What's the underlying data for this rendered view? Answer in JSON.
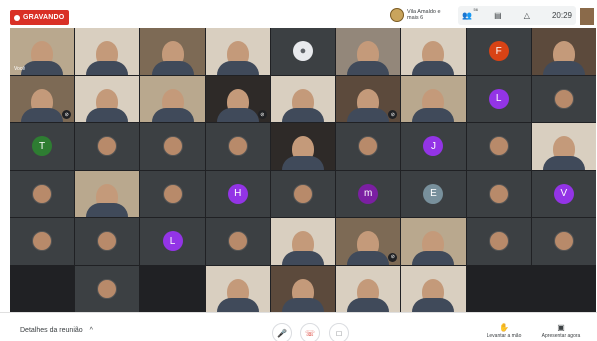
{
  "topbar": {
    "recording_label": "GRAVANDO",
    "pinned_name": "Vila Amaldo e mais 6",
    "people_icon": "people-icon",
    "people_count": "56",
    "chat_icon": "chat-icon",
    "activities_icon": "activities-icon",
    "clock": "20:29"
  },
  "grid": {
    "self_label": "Você",
    "tiles": [
      {
        "kind": "video",
        "bg": "wall-a",
        "label": "Você",
        "mic_off": false
      },
      {
        "kind": "video",
        "bg": "wall-c",
        "label": "",
        "mic_off": false
      },
      {
        "kind": "video",
        "bg": "wall-b",
        "label": "",
        "mic_off": false
      },
      {
        "kind": "video",
        "bg": "wall-c",
        "label": "",
        "mic_off": false
      },
      {
        "kind": "generic",
        "label": ""
      },
      {
        "kind": "video",
        "bg": "wall-e",
        "label": "",
        "mic_off": false
      },
      {
        "kind": "video",
        "bg": "wall-c",
        "label": "",
        "mic_off": false
      },
      {
        "kind": "letter",
        "letter": "F",
        "color": "#d84315"
      },
      {
        "kind": "video",
        "bg": "wall-d",
        "label": "",
        "mic_off": false
      },
      {
        "kind": "video",
        "bg": "wall-b",
        "label": "",
        "mic_off": true
      },
      {
        "kind": "video",
        "bg": "wall-c",
        "label": "",
        "mic_off": false
      },
      {
        "kind": "video",
        "bg": "wall-a",
        "label": "",
        "mic_off": false
      },
      {
        "kind": "video",
        "bg": "wall-f",
        "label": "",
        "mic_off": true
      },
      {
        "kind": "video",
        "bg": "wall-c",
        "label": "",
        "mic_off": false
      },
      {
        "kind": "video",
        "bg": "wall-d",
        "label": "",
        "mic_off": true
      },
      {
        "kind": "video",
        "bg": "wall-a",
        "label": "",
        "mic_off": false
      },
      {
        "kind": "letter",
        "letter": "L",
        "color": "#9334e6"
      },
      {
        "kind": "avatar"
      },
      {
        "kind": "letter",
        "letter": "T",
        "color": "#2e7d32"
      },
      {
        "kind": "avatar"
      },
      {
        "kind": "avatar"
      },
      {
        "kind": "avatar"
      },
      {
        "kind": "video",
        "bg": "wall-f",
        "label": "",
        "mic_off": false
      },
      {
        "kind": "avatar"
      },
      {
        "kind": "letter",
        "letter": "J",
        "color": "#9334e6"
      },
      {
        "kind": "avatar"
      },
      {
        "kind": "video",
        "bg": "wall-c",
        "label": "",
        "mic_off": false
      },
      {
        "kind": "avatar"
      },
      {
        "kind": "video",
        "bg": "wall-a",
        "label": "",
        "mic_off": false
      },
      {
        "kind": "avatar"
      },
      {
        "kind": "letter",
        "letter": "H",
        "color": "#9334e6"
      },
      {
        "kind": "avatar"
      },
      {
        "kind": "letter",
        "letter": "m",
        "color": "#7b1fa2"
      },
      {
        "kind": "letter",
        "letter": "E",
        "color": "#78909c"
      },
      {
        "kind": "avatar"
      },
      {
        "kind": "letter",
        "letter": "V",
        "color": "#9334e6"
      },
      {
        "kind": "avatar"
      },
      {
        "kind": "avatar"
      },
      {
        "kind": "letter",
        "letter": "L",
        "color": "#9334e6"
      },
      {
        "kind": "avatar"
      },
      {
        "kind": "video",
        "bg": "wall-c",
        "label": "",
        "mic_off": false
      },
      {
        "kind": "video",
        "bg": "wall-b",
        "label": "",
        "mic_off": true
      },
      {
        "kind": "video",
        "bg": "wall-a",
        "label": "",
        "mic_off": false
      },
      {
        "kind": "avatar"
      },
      {
        "kind": "avatar"
      },
      {
        "kind": "empty"
      },
      {
        "kind": "avatar"
      },
      {
        "kind": "empty"
      },
      {
        "kind": "video",
        "bg": "wall-c",
        "label": "",
        "mic_off": false
      },
      {
        "kind": "video",
        "bg": "wall-d",
        "label": "",
        "mic_off": false
      },
      {
        "kind": "video",
        "bg": "wall-c",
        "label": "",
        "mic_off": false
      },
      {
        "kind": "video",
        "bg": "wall-c",
        "label": "",
        "mic_off": false
      },
      {
        "kind": "empty"
      },
      {
        "kind": "empty"
      }
    ]
  },
  "bottombar": {
    "meeting_details": "Detalhes da reunião",
    "raise_hand": "Levantar a mão",
    "present_now": "Apresentar agora"
  }
}
